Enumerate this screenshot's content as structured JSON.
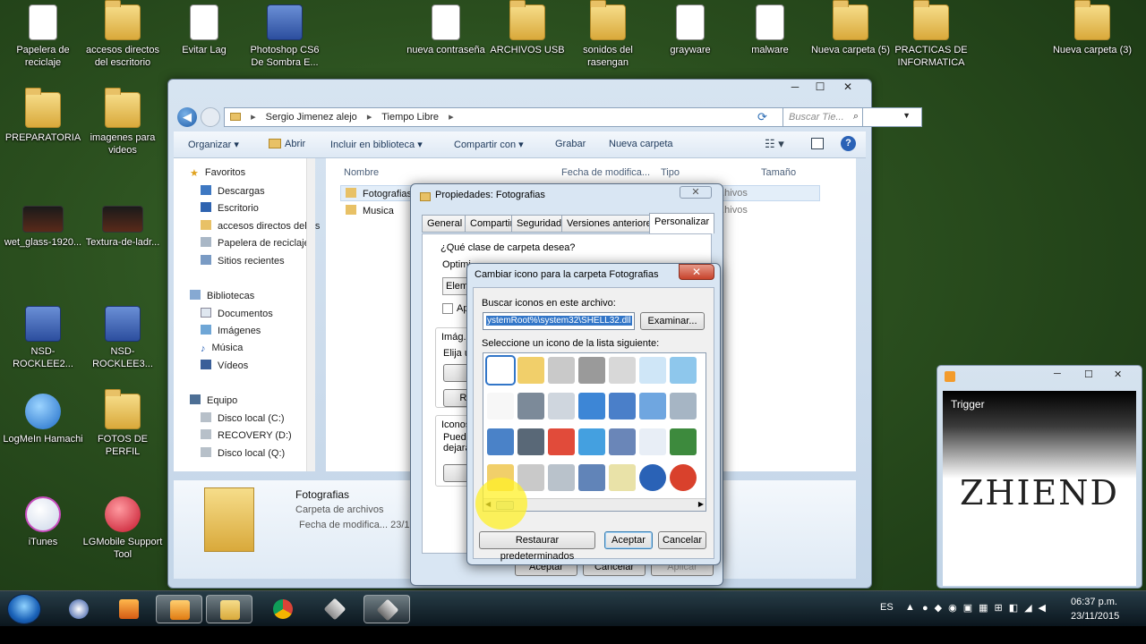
{
  "desktop": {
    "icons": [
      {
        "label": "Papelera de reciclaje",
        "type": "doc"
      },
      {
        "label": "accesos directos del escritorio",
        "type": "folder"
      },
      {
        "label": "Evitar Lag",
        "type": "doc"
      },
      {
        "label": "Photoshop CS6 De Sombra E...",
        "type": "app"
      },
      {
        "label": "nueva contraseña",
        "type": "doc"
      },
      {
        "label": "ARCHIVOS USB",
        "type": "folder"
      },
      {
        "label": "sonidos del rasengan",
        "type": "folder"
      },
      {
        "label": "grayware",
        "type": "doc"
      },
      {
        "label": "malware",
        "type": "doc"
      },
      {
        "label": "Nueva carpeta (5)",
        "type": "folder"
      },
      {
        "label": "PRACTICAS DE INFORMATICA",
        "type": "folder"
      },
      {
        "label": "Nueva carpeta (3)",
        "type": "folder"
      },
      {
        "label": "PREPARATORIA",
        "type": "folder"
      },
      {
        "label": "imagenes para videos",
        "type": "folder"
      },
      {
        "label": "wet_glass-1920...",
        "type": "dark"
      },
      {
        "label": "Textura-de-ladr...",
        "type": "dark"
      },
      {
        "label": "NSD-ROCKLEE2...",
        "type": "app"
      },
      {
        "label": "NSD-ROCKLEE3...",
        "type": "app"
      },
      {
        "label": "LogMeIn Hamachi",
        "type": "round"
      },
      {
        "label": "FOTOS DE PERFIL",
        "type": "folder"
      },
      {
        "label": "iTunes",
        "type": "itunes"
      },
      {
        "label": "LGMobile Support Tool",
        "type": "lgm"
      }
    ]
  },
  "explorer": {
    "breadcrumb": [
      "Sergio Jimenez alejo",
      "Tiempo Libre"
    ],
    "search_placeholder": "Buscar Tie...",
    "toolbar": {
      "organize": "Organizar ▾",
      "open": "Abrir",
      "include": "Incluir en biblioteca ▾",
      "share": "Compartir con ▾",
      "burn": "Grabar",
      "new_folder": "Nueva carpeta"
    },
    "nav": {
      "favorites": "Favoritos",
      "fav_items": [
        "Descargas",
        "Escritorio",
        "accesos directos del es",
        "Papelera de reciclaje",
        "Sitios recientes"
      ],
      "libraries": "Bibliotecas",
      "lib_items": [
        "Documentos",
        "Imágenes",
        "Música",
        "Vídeos"
      ],
      "computer": "Equipo",
      "computer_items": [
        "Disco local (C:)",
        "RECOVERY (D:)",
        "Disco local (Q:)"
      ]
    },
    "columns": [
      "Nombre",
      "Fecha de modifica...",
      "Tipo",
      "Tamaño"
    ],
    "files": [
      {
        "name": "Fotografias",
        "type": "...hivos"
      },
      {
        "name": "Musica",
        "type": "...hivos"
      }
    ],
    "details": {
      "name": "Fotografias",
      "kind": "Carpeta de archivos",
      "date": "Fecha de modifica... 23/1..."
    }
  },
  "properties_dialog": {
    "title": "Propiedades: Fotografias",
    "tabs": [
      "General",
      "Compartir",
      "Seguridad",
      "Versiones anteriores",
      "Personalizar"
    ],
    "question": "¿Qué clase de carpeta desea?",
    "optimize": "Optimi...",
    "optimize_value": "Eleme...",
    "apply_checkbox": "Ap...",
    "images_group": "Imág...",
    "choose": "Elija u...",
    "restore_btn": "Re...",
    "icons_group": "Iconos...",
    "can_text": "Puede...",
    "leave_text": "dejará...",
    "buttons": {
      "accept": "Aceptar",
      "cancel": "Cancelar",
      "apply": "Aplicar"
    }
  },
  "change_icon_dialog": {
    "title": "Cambiar icono para la carpeta Fotografias",
    "file_label": "Buscar iconos en este archivo:",
    "file_value": "ystemRoot%\\system32\\SHELL32.dll",
    "browse_btn": "Examinar...",
    "list_label": "Seleccione un icono de la lista siguiente:",
    "buttons": {
      "restore": "Restaurar predeterminados",
      "accept": "Aceptar",
      "cancel": "Cancelar"
    }
  },
  "trigger_window": {
    "title": "Trigger",
    "logo_text": "ZHIEND"
  },
  "taskbar": {
    "lang": "ES",
    "time": "06:37 p.m.",
    "date": "23/11/2015"
  }
}
